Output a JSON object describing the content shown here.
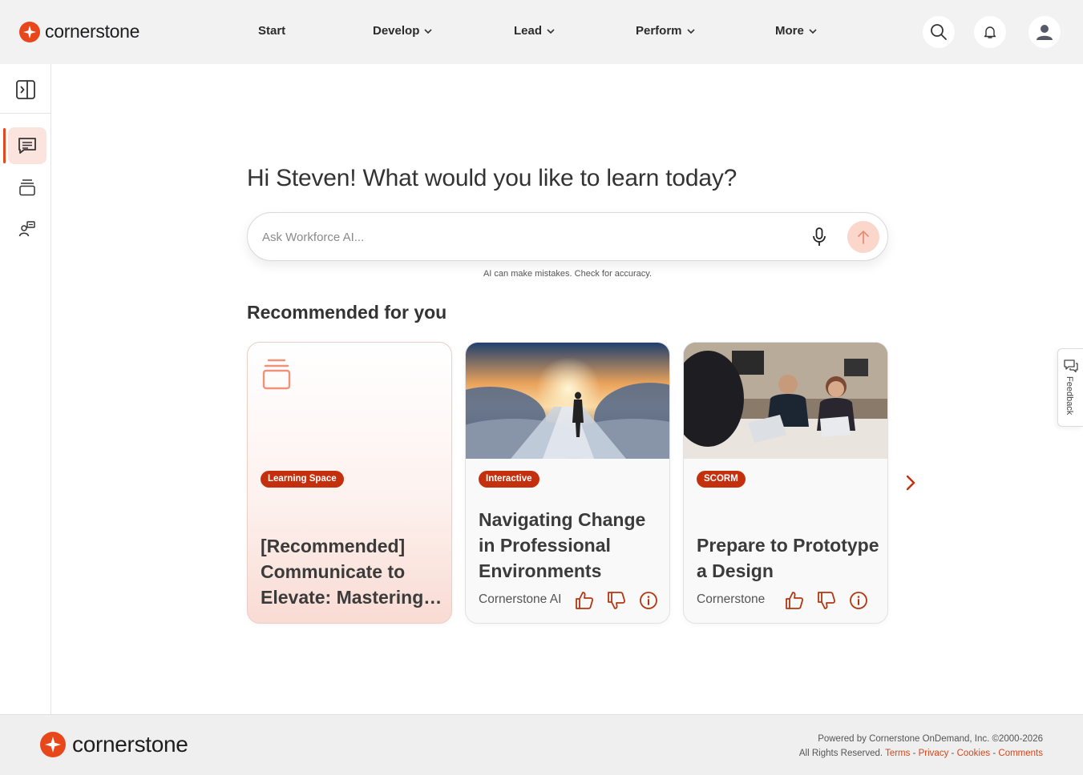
{
  "brand": {
    "name": "cornerstone",
    "color": "#e8471c"
  },
  "nav": {
    "items": [
      {
        "label": "Start",
        "has_dropdown": false
      },
      {
        "label": "Develop",
        "has_dropdown": true
      },
      {
        "label": "Lead",
        "has_dropdown": true
      },
      {
        "label": "Perform",
        "has_dropdown": true
      },
      {
        "label": "More",
        "has_dropdown": true
      }
    ],
    "icons": [
      "search-icon",
      "bell-icon",
      "user-icon"
    ]
  },
  "sidebar": {
    "items": [
      {
        "icon": "chat-icon",
        "active": true
      },
      {
        "icon": "stack-icon",
        "active": false
      },
      {
        "icon": "people-icon",
        "active": false
      }
    ]
  },
  "main": {
    "greeting": "Hi Steven! What would you like to learn today?",
    "ask": {
      "placeholder": "Ask Workforce AI...",
      "value": "",
      "disclaimer": "AI can make mistakes. Check for accuracy."
    },
    "recommended_title": "Recommended for you",
    "cards": [
      {
        "badge": "Learning Space",
        "title": "[Recommended] Communicate to Elevate: Mastering…",
        "provider": ""
      },
      {
        "badge": "Interactive",
        "title": "Navigating Change in Professional Environments",
        "provider": "Cornerstone AI"
      },
      {
        "badge": "SCORM",
        "title": "Prepare to Prototype a Design",
        "provider": "Cornerstone"
      }
    ]
  },
  "feedback": {
    "label": "Feedback"
  },
  "footer": {
    "powered_by": "Powered by Cornerstone OnDemand, Inc. ©2000-2026",
    "rights": "All Rights Reserved.",
    "links": {
      "terms": "Terms",
      "privacy": "Privacy",
      "cookies": "Cookies",
      "comments": "Comments"
    },
    "separator": "-"
  }
}
